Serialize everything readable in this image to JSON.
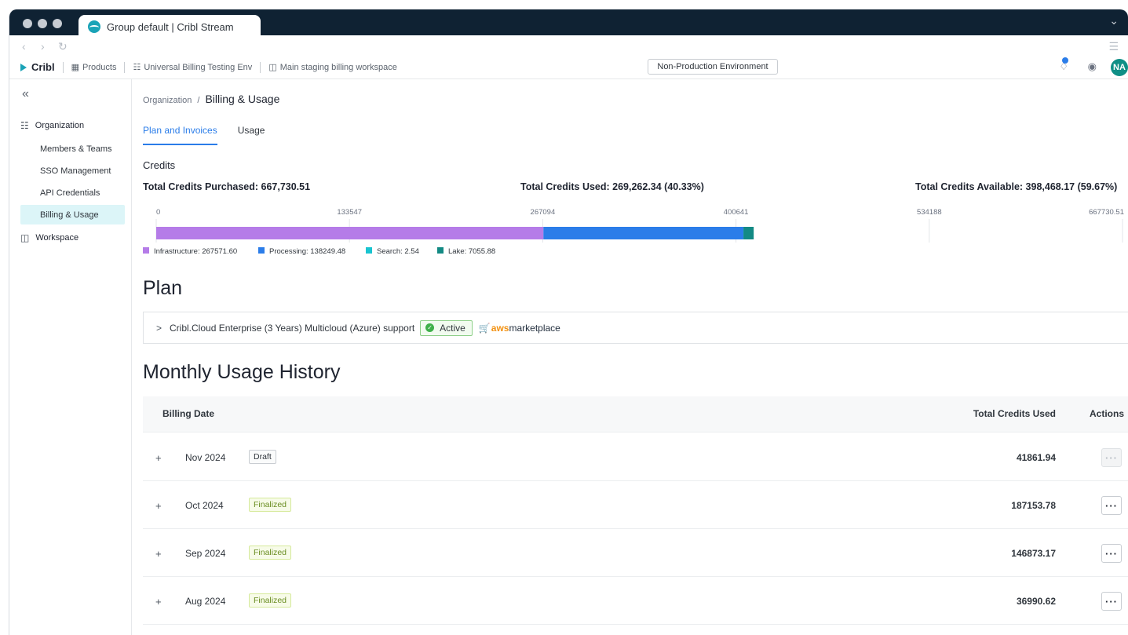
{
  "browser": {
    "tab_title": "Group default | Cribl Stream"
  },
  "topbar": {
    "brand": "Cribl",
    "products": "Products",
    "org": "Universal Billing Testing Env",
    "workspace": "Main staging billing workspace",
    "environment": "Non-Production Environment",
    "avatar": "NA"
  },
  "sidebar": {
    "organization": "Organization",
    "items": [
      "Members & Teams",
      "SSO Management",
      "API Credentials",
      "Billing & Usage"
    ],
    "workspace": "Workspace"
  },
  "breadcrumb": {
    "parent": "Organization",
    "separator": "/",
    "current": "Billing & Usage"
  },
  "tabs": [
    "Plan and Invoices",
    "Usage"
  ],
  "credits": {
    "label": "Credits",
    "purchased": "Total Credits Purchased: 667,730.51",
    "used": "Total Credits Used: 269,262.34 (40.33%)",
    "available": "Total Credits Available: 398,468.17 (59.67%)"
  },
  "chart_data": {
    "type": "bar",
    "orientation": "horizontal-stacked",
    "xlim": [
      0,
      667730.51
    ],
    "ticks": [
      "0",
      "133547",
      "267094",
      "400641",
      "534188",
      "667730.51"
    ],
    "tick_values": [
      0,
      133547,
      267094,
      400641,
      534188,
      667730.51
    ],
    "series": [
      {
        "name": "Infrastructure",
        "value": 267571.6,
        "label": "Infrastructure: 267571.60",
        "color": "#b57ce8"
      },
      {
        "name": "Processing",
        "value": 138249.48,
        "label": "Processing: 138249.48",
        "color": "#2b7de9"
      },
      {
        "name": "Search",
        "value": 2.54,
        "label": "Search: 2.54",
        "color": "#19c4d0"
      },
      {
        "name": "Lake",
        "value": 7055.88,
        "label": "Lake: 7055.88",
        "color": "#138a84"
      }
    ]
  },
  "plan": {
    "title": "Plan",
    "name": "Cribl.Cloud Enterprise (3 Years) Multicloud (Azure) support",
    "status": "Active",
    "marketplace_prefix": "aws",
    "marketplace_suffix": "marketplace"
  },
  "history": {
    "title": "Monthly Usage History",
    "columns": {
      "date": "Billing Date",
      "total": "Total Credits Used",
      "actions": "Actions"
    },
    "rows": [
      {
        "date": "Nov 2024",
        "status": "Draft",
        "total": "41861.94",
        "actions": "···"
      },
      {
        "date": "Oct 2024",
        "status": "Finalized",
        "total": "187153.78",
        "actions": "···"
      },
      {
        "date": "Sep 2024",
        "status": "Finalized",
        "total": "146873.17",
        "actions": "···"
      },
      {
        "date": "Aug 2024",
        "status": "Finalized",
        "total": "36990.62",
        "actions": "···"
      }
    ]
  },
  "colors": {
    "accent": "#2b7de9",
    "brand": "#1aa3b7",
    "active_nav": "#dcf5f8"
  }
}
